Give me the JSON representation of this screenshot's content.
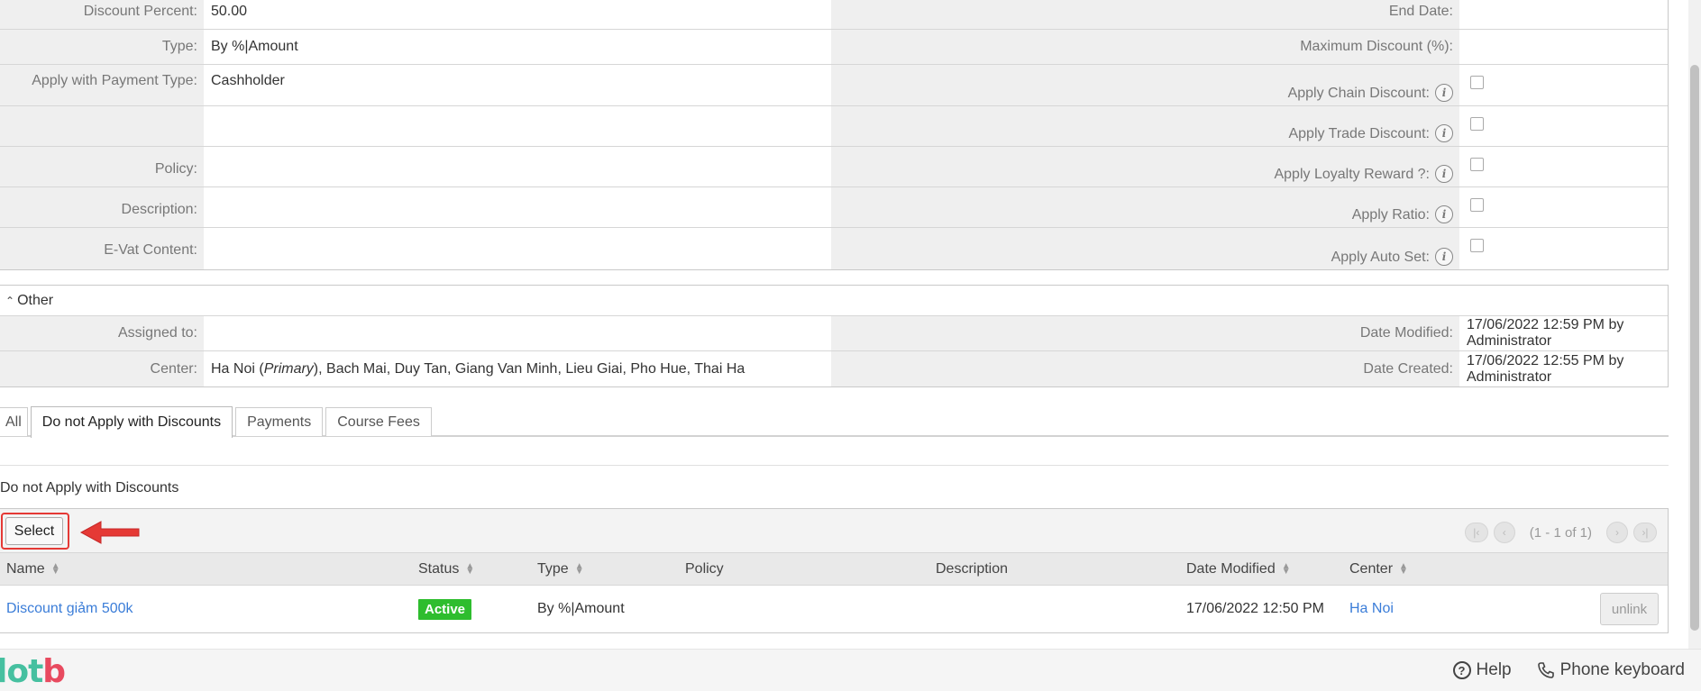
{
  "detail": {
    "rows": [
      {
        "left_label": "Discount Percent:",
        "left_value": "50.00",
        "right_label": "End Date:",
        "right_value": ""
      },
      {
        "left_label": "Type:",
        "left_value": "By %|Amount",
        "right_label": "Maximum Discount (%):",
        "right_value": ""
      },
      {
        "left_label": "Apply with Payment Type:",
        "left_value": "Cashholder",
        "right_label": "Apply Chain Discount:",
        "right_info": true
      },
      {
        "left_label": "",
        "left_value": "",
        "right_label": "Apply Trade Discount:",
        "right_info": true
      },
      {
        "left_label": "Policy:",
        "left_value": "",
        "right_label": "Apply Loyalty Reward ?:",
        "right_info": true
      },
      {
        "left_label": "Description:",
        "left_value": "",
        "right_label": "Apply Ratio:",
        "right_info": true
      },
      {
        "left_label": "E-Vat Content:",
        "left_value": "",
        "right_label": "Apply Auto Set:",
        "right_info": true
      }
    ],
    "checkboxes": [
      false,
      false,
      false,
      false,
      false
    ]
  },
  "other": {
    "title": "Other",
    "assigned_label": "Assigned to:",
    "assigned_value": "",
    "date_modified_label": "Date Modified:",
    "date_modified_value": "17/06/2022 12:59 PM by Administrator",
    "center_label": "Center:",
    "center_primary_name": "Ha Noi",
    "center_primary_tag": "Primary",
    "center_rest": "), Bach Mai, Duy Tan, Giang Van Minh, Lieu Giai, Pho Hue, Thai Ha",
    "date_created_label": "Date Created:",
    "date_created_value": "17/06/2022 12:55 PM by Administrator"
  },
  "tabs": [
    "All",
    "Do not Apply with Discounts",
    "Payments",
    "Course Fees"
  ],
  "active_tab": "Do not Apply with Discounts",
  "subpanel": {
    "title": "Do not Apply with Discounts",
    "select_label": "Select",
    "pager_text": "(1 - 1 of 1)",
    "columns": [
      "Name",
      "Status",
      "Type",
      "Policy",
      "Description",
      "Date Modified",
      "Center"
    ],
    "row": {
      "name": "Discount giảm 500k",
      "status": "Active",
      "type": "By %|Amount",
      "policy": "",
      "description": "",
      "date_modified": "17/06/2022 12:50 PM",
      "center": "Ha Noi",
      "unlink_label": "unlink"
    }
  },
  "footer": {
    "logo_text_a": "lot",
    "logo_text_b": "b",
    "help_label": "Help",
    "phone_label": "Phone keyboard"
  },
  "colors": {
    "status_active": "#2ebd2e",
    "link": "#3b7dd8",
    "highlight": "#e53935"
  }
}
